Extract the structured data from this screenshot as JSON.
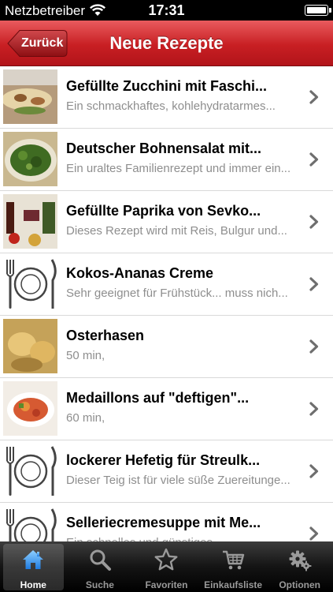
{
  "status_bar": {
    "carrier": "Netzbetreiber",
    "time": "17:31"
  },
  "nav": {
    "back_label": "Zurück",
    "title": "Neue Rezepte"
  },
  "recipes": [
    {
      "title": "Gefüllte Zucchini mit Faschi...",
      "subtitle": "Ein schmackhaftes, kohlehydratarmes..."
    },
    {
      "title": "Deutscher Bohnensalat mit...",
      "subtitle": "Ein uraltes Familienrezept und immer ein..."
    },
    {
      "title": "Gefüllte Paprika von Sevko...",
      "subtitle": "Dieses Rezept wird mit Reis, Bulgur und..."
    },
    {
      "title": "Kokos-Ananas Creme",
      "subtitle": "Sehr geeignet für Frühstück... muss nich..."
    },
    {
      "title": "Osterhasen",
      "subtitle": "50 min,"
    },
    {
      "title": "Medaillons auf \"deftigen\"...",
      "subtitle": "60 min,"
    },
    {
      "title": "lockerer Hefetig für Streulk...",
      "subtitle": "Dieser Teig ist für viele süße Zuereitunge..."
    },
    {
      "title": "Selleriecremesuppe mit Me...",
      "subtitle": "Ein schnelles und günstiges..."
    }
  ],
  "tabs": [
    {
      "label": "Home",
      "icon": "home-icon",
      "selected": true
    },
    {
      "label": "Suche",
      "icon": "search-icon",
      "selected": false
    },
    {
      "label": "Favoriten",
      "icon": "star-icon",
      "selected": false
    },
    {
      "label": "Einkaufsliste",
      "icon": "cart-icon",
      "selected": false
    },
    {
      "label": "Optionen",
      "icon": "gear-icon",
      "selected": false
    }
  ],
  "colors": {
    "nav_red": "#c81f23",
    "tab_active_blue": "#4aa3ff"
  }
}
